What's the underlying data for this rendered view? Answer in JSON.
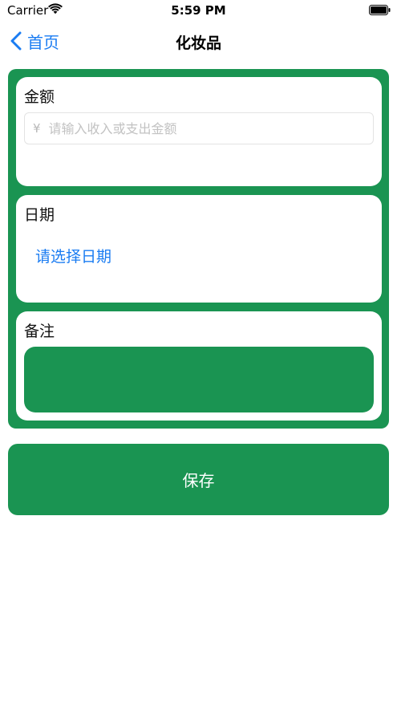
{
  "status_bar": {
    "carrier": "Carrier",
    "time": "5:59 PM",
    "wifi_icon": "wifi-icon",
    "battery_icon": "battery-icon"
  },
  "nav": {
    "back_label": "首页",
    "back_icon": "chevron-left-icon",
    "title": "化妆品"
  },
  "form": {
    "amount": {
      "label": "金额",
      "currency_symbol": "¥",
      "value": "",
      "placeholder": "请输入收入或支出金额"
    },
    "date": {
      "label": "日期",
      "picker_text": "请选择日期"
    },
    "note": {
      "label": "备注",
      "value": ""
    }
  },
  "save_button": {
    "label": "保存"
  },
  "colors": {
    "accent_green": "#1a9452",
    "link_blue": "#1a7cf2",
    "background": "#ffffff"
  }
}
